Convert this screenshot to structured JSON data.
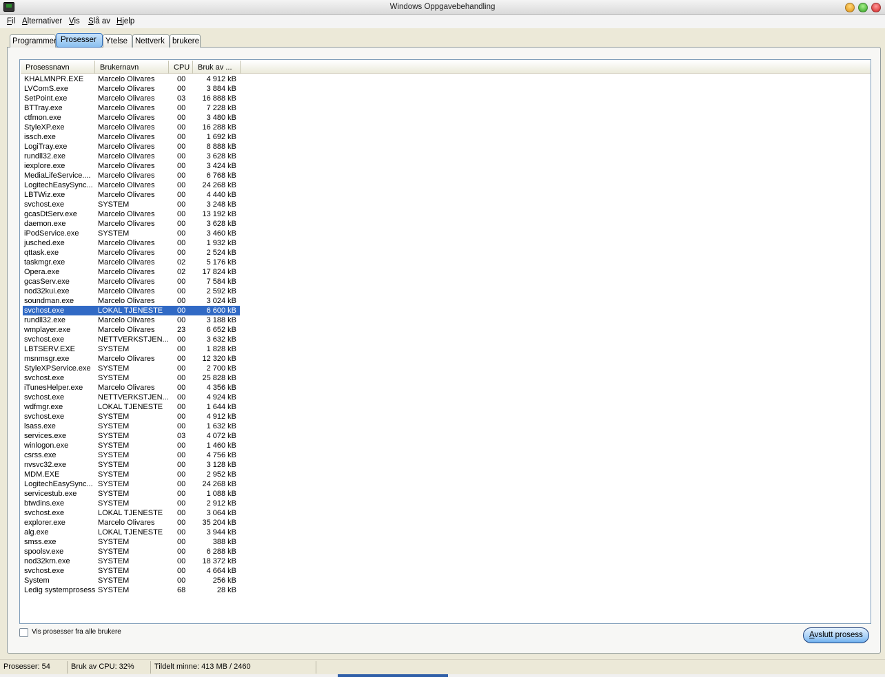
{
  "window": {
    "title": "Windows Oppgavebehandling"
  },
  "menu": [
    "Fil",
    "Alternativer",
    "Vis",
    "Slå av",
    "Hjelp"
  ],
  "tabs": [
    "Programmer",
    "Prosesser",
    "Ytelse",
    "Nettverk",
    "brukere"
  ],
  "active_tab": "Prosesser",
  "columns": [
    "Prosessnavn",
    "Brukernavn",
    "CPU",
    "Bruk av ..."
  ],
  "rows": [
    [
      "KHALMNPR.EXE",
      "Marcelo Olivares",
      "00",
      "4 912 kB"
    ],
    [
      "LVComS.exe",
      "Marcelo Olivares",
      "00",
      "3 884 kB"
    ],
    [
      "SetPoint.exe",
      "Marcelo Olivares",
      "03",
      "16 888 kB"
    ],
    [
      "BTTray.exe",
      "Marcelo Olivares",
      "00",
      "7 228 kB"
    ],
    [
      "ctfmon.exe",
      "Marcelo Olivares",
      "00",
      "3 480 kB"
    ],
    [
      "StyleXP.exe",
      "Marcelo Olivares",
      "00",
      "16 288 kB"
    ],
    [
      "issch.exe",
      "Marcelo Olivares",
      "00",
      "1 692 kB"
    ],
    [
      "LogiTray.exe",
      "Marcelo Olivares",
      "00",
      "8 888 kB"
    ],
    [
      "rundll32.exe",
      "Marcelo Olivares",
      "00",
      "3 628 kB"
    ],
    [
      "iexplore.exe",
      "Marcelo Olivares",
      "00",
      "3 424 kB"
    ],
    [
      "MediaLifeService....",
      "Marcelo Olivares",
      "00",
      "6 768 kB"
    ],
    [
      "LogitechEasySync...",
      "Marcelo Olivares",
      "00",
      "24 268 kB"
    ],
    [
      "LBTWiz.exe",
      "Marcelo Olivares",
      "00",
      "4 440 kB"
    ],
    [
      "svchost.exe",
      "SYSTEM",
      "00",
      "3 248 kB"
    ],
    [
      "gcasDtServ.exe",
      "Marcelo Olivares",
      "00",
      "13 192 kB"
    ],
    [
      "daemon.exe",
      "Marcelo Olivares",
      "00",
      "3 628 kB"
    ],
    [
      "iPodService.exe",
      "SYSTEM",
      "00",
      "3 460 kB"
    ],
    [
      "jusched.exe",
      "Marcelo Olivares",
      "00",
      "1 932 kB"
    ],
    [
      "qttask.exe",
      "Marcelo Olivares",
      "00",
      "2 524 kB"
    ],
    [
      "taskmgr.exe",
      "Marcelo Olivares",
      "02",
      "5 176 kB"
    ],
    [
      "Opera.exe",
      "Marcelo Olivares",
      "02",
      "17 824 kB"
    ],
    [
      "gcasServ.exe",
      "Marcelo Olivares",
      "00",
      "7 584 kB"
    ],
    [
      "nod32kui.exe",
      "Marcelo Olivares",
      "00",
      "2 592 kB"
    ],
    [
      "soundman.exe",
      "Marcelo Olivares",
      "00",
      "3 024 kB"
    ],
    [
      "svchost.exe",
      "LOKAL TJENESTE",
      "00",
      "6 600 kB"
    ],
    [
      "rundll32.exe",
      "Marcelo Olivares",
      "00",
      "3 188 kB"
    ],
    [
      "wmplayer.exe",
      "Marcelo Olivares",
      "23",
      "6 652 kB"
    ],
    [
      "svchost.exe",
      "NETTVERKSTJEN...",
      "00",
      "3 632 kB"
    ],
    [
      "LBTSERV.EXE",
      "SYSTEM",
      "00",
      "1 828 kB"
    ],
    [
      "msnmsgr.exe",
      "Marcelo Olivares",
      "00",
      "12 320 kB"
    ],
    [
      "StyleXPService.exe",
      "SYSTEM",
      "00",
      "2 700 kB"
    ],
    [
      "svchost.exe",
      "SYSTEM",
      "00",
      "25 828 kB"
    ],
    [
      "iTunesHelper.exe",
      "Marcelo Olivares",
      "00",
      "4 356 kB"
    ],
    [
      "svchost.exe",
      "NETTVERKSTJEN...",
      "00",
      "4 924 kB"
    ],
    [
      "wdfmgr.exe",
      "LOKAL TJENESTE",
      "00",
      "1 644 kB"
    ],
    [
      "svchost.exe",
      "SYSTEM",
      "00",
      "4 912 kB"
    ],
    [
      "lsass.exe",
      "SYSTEM",
      "00",
      "1 632 kB"
    ],
    [
      "services.exe",
      "SYSTEM",
      "03",
      "4 072 kB"
    ],
    [
      "winlogon.exe",
      "SYSTEM",
      "00",
      "1 460 kB"
    ],
    [
      "csrss.exe",
      "SYSTEM",
      "00",
      "4 756 kB"
    ],
    [
      "nvsvc32.exe",
      "SYSTEM",
      "00",
      "3 128 kB"
    ],
    [
      "MDM.EXE",
      "SYSTEM",
      "00",
      "2 952 kB"
    ],
    [
      "LogitechEasySync...",
      "SYSTEM",
      "00",
      "24 268 kB"
    ],
    [
      "servicestub.exe",
      "SYSTEM",
      "00",
      "1 088 kB"
    ],
    [
      "btwdins.exe",
      "SYSTEM",
      "00",
      "2 912 kB"
    ],
    [
      "svchost.exe",
      "LOKAL TJENESTE",
      "00",
      "3 064 kB"
    ],
    [
      "explorer.exe",
      "Marcelo Olivares",
      "00",
      "35 204 kB"
    ],
    [
      "alg.exe",
      "LOKAL TJENESTE",
      "00",
      "3 944 kB"
    ],
    [
      "smss.exe",
      "SYSTEM",
      "00",
      "388 kB"
    ],
    [
      "spoolsv.exe",
      "SYSTEM",
      "00",
      "6 288 kB"
    ],
    [
      "nod32krn.exe",
      "SYSTEM",
      "00",
      "18 372 kB"
    ],
    [
      "svchost.exe",
      "SYSTEM",
      "00",
      "4 664 kB"
    ],
    [
      "System",
      "SYSTEM",
      "00",
      "256 kB"
    ],
    [
      "Ledig systemprosess",
      "SYSTEM",
      "68",
      "28 kB"
    ]
  ],
  "selected_row": 24,
  "show_all_users_label": "Vis prosesser fra alle brukere",
  "show_all_users_checked": false,
  "end_process_label": "Avslutt prosess",
  "status": {
    "processes": "Prosesser: 54",
    "cpu": "Bruk av CPU: 32%",
    "memory": "Tildelt minne: 413 MB / 2460"
  },
  "colors": {
    "selection": "#316ac5",
    "minimize": "#f0a020",
    "maximize": "#40b030",
    "close": "#e03030"
  }
}
